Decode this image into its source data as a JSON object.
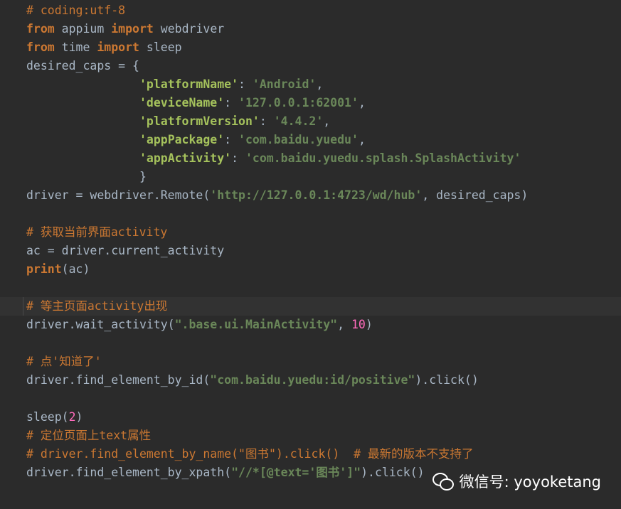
{
  "editor": {
    "lines": [
      [
        {
          "t": "# coding:utf-8",
          "c": "cmt"
        }
      ],
      [
        {
          "t": "from",
          "c": "kw"
        },
        {
          "t": " appium ",
          "c": "plain"
        },
        {
          "t": "import",
          "c": "kw"
        },
        {
          "t": " webdriver",
          "c": "plain"
        }
      ],
      [
        {
          "t": "from",
          "c": "kw"
        },
        {
          "t": " time ",
          "c": "plain"
        },
        {
          "t": "import",
          "c": "kw"
        },
        {
          "t": " sleep",
          "c": "plain"
        }
      ],
      [
        {
          "t": "desired_caps = {",
          "c": "plain"
        }
      ],
      [
        {
          "t": "                ",
          "c": "plain"
        },
        {
          "t": "'platformName'",
          "c": "str-key"
        },
        {
          "t": ": ",
          "c": "plain"
        },
        {
          "t": "'Android'",
          "c": "str"
        },
        {
          "t": ",",
          "c": "plain"
        }
      ],
      [
        {
          "t": "                ",
          "c": "plain"
        },
        {
          "t": "'deviceName'",
          "c": "str-key"
        },
        {
          "t": ": ",
          "c": "plain"
        },
        {
          "t": "'127.0.0.1:62001'",
          "c": "str"
        },
        {
          "t": ",",
          "c": "plain"
        }
      ],
      [
        {
          "t": "                ",
          "c": "plain"
        },
        {
          "t": "'platformVersion'",
          "c": "str-key"
        },
        {
          "t": ": ",
          "c": "plain"
        },
        {
          "t": "'4.4.2'",
          "c": "str"
        },
        {
          "t": ",",
          "c": "plain"
        }
      ],
      [
        {
          "t": "                ",
          "c": "plain"
        },
        {
          "t": "'appPackage'",
          "c": "str-key"
        },
        {
          "t": ": ",
          "c": "plain"
        },
        {
          "t": "'com.baidu.yuedu'",
          "c": "str"
        },
        {
          "t": ",",
          "c": "plain"
        }
      ],
      [
        {
          "t": "                ",
          "c": "plain"
        },
        {
          "t": "'appActivity'",
          "c": "str-key"
        },
        {
          "t": ": ",
          "c": "plain"
        },
        {
          "t": "'com.baidu.yuedu.splash.SplashActivity'",
          "c": "str"
        }
      ],
      [
        {
          "t": "                }",
          "c": "plain"
        }
      ],
      [
        {
          "t": "driver = webdriver.Remote(",
          "c": "plain"
        },
        {
          "t": "'http://127.0.0.1:4723/wd/hub'",
          "c": "str"
        },
        {
          "t": ", desired_caps)",
          "c": "plain"
        }
      ],
      [
        {
          "t": "",
          "c": "plain"
        }
      ],
      [
        {
          "t": "# 获取当前界面activity",
          "c": "cmt"
        }
      ],
      [
        {
          "t": "ac = driver.current_activity",
          "c": "plain"
        }
      ],
      [
        {
          "t": "print",
          "c": "builtin"
        },
        {
          "t": "(ac)",
          "c": "plain"
        }
      ],
      [
        {
          "t": "",
          "c": "plain"
        }
      ],
      [
        {
          "t": "# 等主页面activity出现",
          "c": "cmt"
        }
      ],
      [
        {
          "t": "driver.wait_activity(",
          "c": "plain"
        },
        {
          "t": "\".base.ui.MainActivity\"",
          "c": "str"
        },
        {
          "t": ", ",
          "c": "plain"
        },
        {
          "t": "10",
          "c": "num"
        },
        {
          "t": ")",
          "c": "plain"
        }
      ],
      [
        {
          "t": "",
          "c": "plain"
        }
      ],
      [
        {
          "t": "# 点'知道了'",
          "c": "cmt"
        }
      ],
      [
        {
          "t": "driver.find_element_by_id(",
          "c": "plain"
        },
        {
          "t": "\"com.baidu.yuedu:id/positive\"",
          "c": "str"
        },
        {
          "t": ").click()",
          "c": "plain"
        }
      ],
      [
        {
          "t": "",
          "c": "plain"
        }
      ],
      [
        {
          "t": "sleep(",
          "c": "plain"
        },
        {
          "t": "2",
          "c": "num"
        },
        {
          "t": ")",
          "c": "plain"
        }
      ],
      [
        {
          "t": "# 定位页面上text属性",
          "c": "cmt"
        }
      ],
      [
        {
          "t": "# driver.find_element_by_name(\"图书\").click()  # 最新的版本不支持了",
          "c": "cmt"
        }
      ],
      [
        {
          "t": "driver.find_element_by_xpath(",
          "c": "plain"
        },
        {
          "t": "\"//*[@text='图书']\"",
          "c": "str"
        },
        {
          "t": ").click()",
          "c": "plain"
        }
      ]
    ],
    "current_line_index": 16
  },
  "watermark": {
    "text": "微信号: yoyoketang",
    "icon": "wechat-icon"
  }
}
